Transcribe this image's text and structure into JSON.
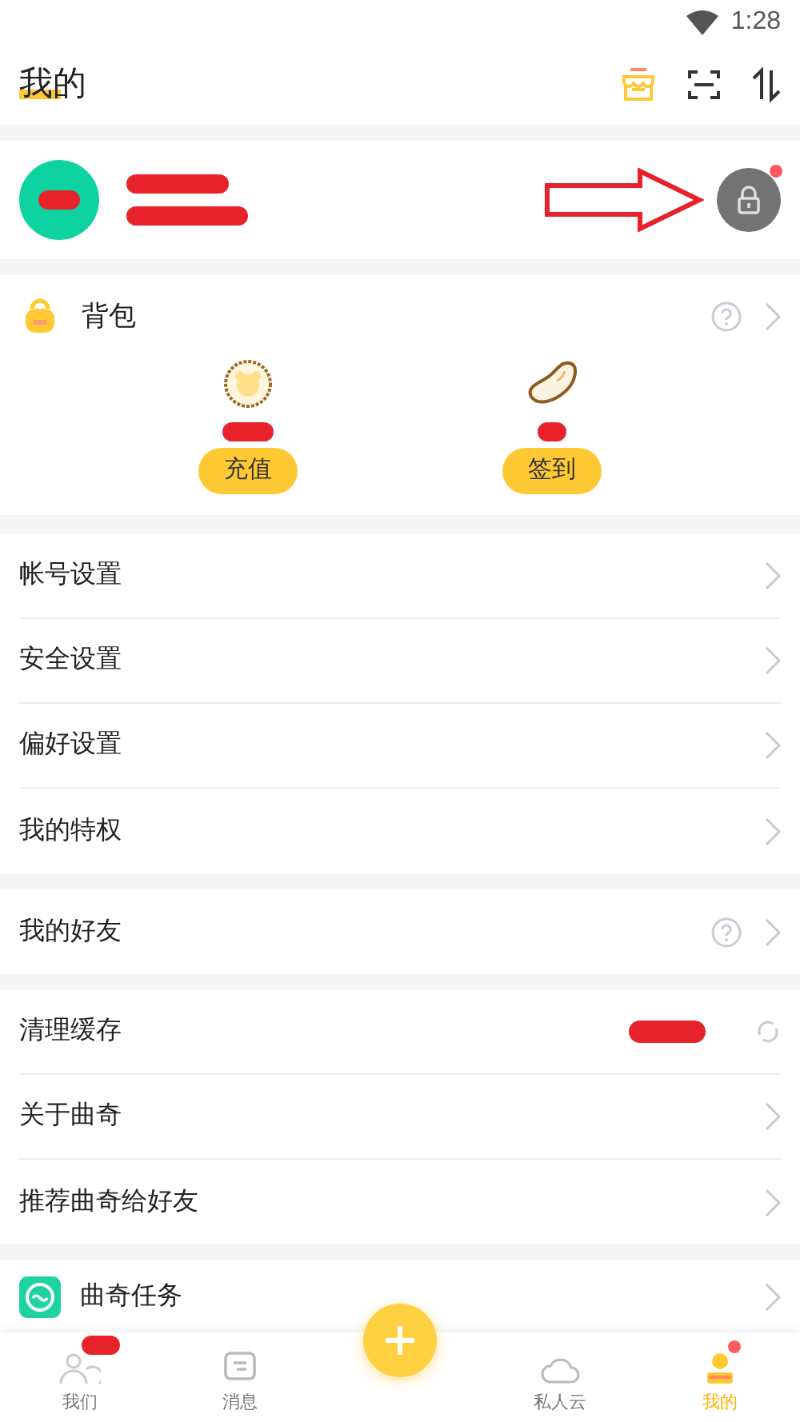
{
  "status_bar": {
    "time": "1:28"
  },
  "header": {
    "title": "我的"
  },
  "profile": {
    "notification_dot": true
  },
  "backpack": {
    "title": "背包",
    "items": [
      {
        "kind": "coin",
        "label": "充值"
      },
      {
        "kind": "bean",
        "label": "签到"
      }
    ]
  },
  "groups": [
    [
      {
        "label": "帐号设置",
        "kind": "link"
      },
      {
        "label": "安全设置",
        "kind": "link"
      },
      {
        "label": "偏好设置",
        "kind": "link"
      },
      {
        "label": "我的特权",
        "kind": "link"
      }
    ],
    [
      {
        "label": "我的好友",
        "kind": "help"
      }
    ],
    [
      {
        "label": "清理缓存",
        "kind": "refresh"
      },
      {
        "label": "关于曲奇",
        "kind": "link"
      },
      {
        "label": "推荐曲奇给好友",
        "kind": "link"
      }
    ],
    [
      {
        "label": "曲奇任务",
        "kind": "task"
      }
    ]
  ],
  "nav": [
    {
      "label": "我们",
      "kind": "people",
      "selected": false,
      "dot": false,
      "redacted": true
    },
    {
      "label": "消息",
      "kind": "message",
      "selected": false,
      "dot": false,
      "redacted": false
    },
    {
      "label": "私人云",
      "kind": "cloud",
      "selected": false,
      "dot": false,
      "redacted": false
    },
    {
      "label": "我的",
      "kind": "me",
      "selected": true,
      "dot": true,
      "redacted": false
    }
  ]
}
